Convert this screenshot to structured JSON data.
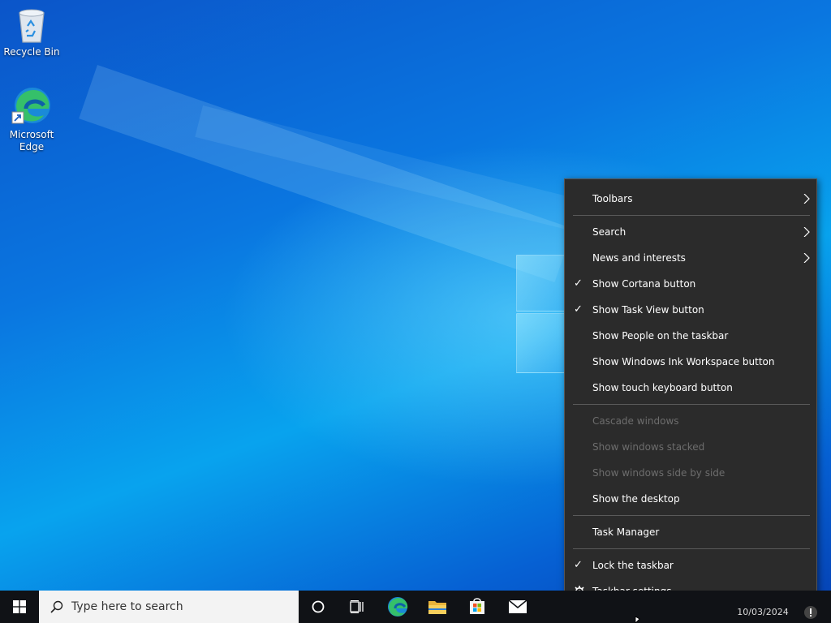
{
  "desktop": {
    "icons": [
      {
        "label": "Recycle Bin",
        "icon": "recycle-bin-icon"
      },
      {
        "label": "Microsoft\nEdge",
        "label_line1": "Microsoft",
        "label_line2": "Edge",
        "icon": "edge-icon"
      }
    ]
  },
  "context_menu": {
    "items": [
      {
        "label": "Toolbars",
        "submenu": true
      },
      {
        "label": "Search",
        "submenu": true
      },
      {
        "label": "News and interests",
        "submenu": true
      },
      {
        "label": "Show Cortana button",
        "checked": true
      },
      {
        "label": "Show Task View button",
        "checked": true
      },
      {
        "label": "Show People on the taskbar"
      },
      {
        "label": "Show Windows Ink Workspace button"
      },
      {
        "label": "Show touch keyboard button"
      },
      {
        "label": "Cascade windows",
        "disabled": true
      },
      {
        "label": "Show windows stacked",
        "disabled": true
      },
      {
        "label": "Show windows side by side",
        "disabled": true
      },
      {
        "label": "Show the desktop"
      },
      {
        "label": "Task Manager"
      },
      {
        "label": "Lock the taskbar",
        "checked": true
      },
      {
        "label": "Taskbar settings",
        "icon": "gear-icon"
      }
    ],
    "check_glyph": "✓"
  },
  "taskbar": {
    "search_placeholder": "Type here to search",
    "clock_date": "10/03/2024",
    "pinned": [
      "cortana-icon",
      "task-view-icon",
      "edge-icon",
      "file-explorer-icon",
      "store-icon",
      "mail-icon"
    ]
  },
  "colors": {
    "taskbar": "#101216",
    "menu_bg": "#2b2b2b",
    "menu_disabled_text": "#6d6d6d",
    "search_bg": "#f3f3f3"
  }
}
